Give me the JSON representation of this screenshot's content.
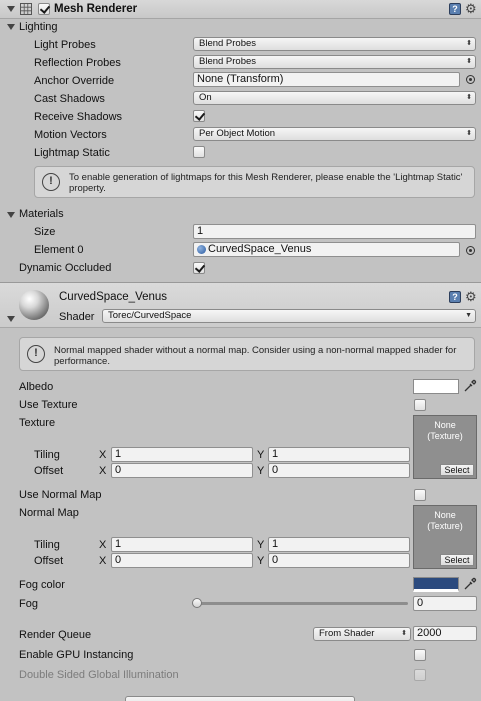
{
  "mesh_renderer": {
    "title": "Mesh Renderer",
    "enabled": true,
    "lighting_label": "Lighting",
    "light_probes": {
      "label": "Light Probes",
      "value": "Blend Probes"
    },
    "reflection_probes": {
      "label": "Reflection Probes",
      "value": "Blend Probes"
    },
    "anchor_override": {
      "label": "Anchor Override",
      "value": "None (Transform)"
    },
    "cast_shadows": {
      "label": "Cast Shadows",
      "value": "On"
    },
    "receive_shadows": {
      "label": "Receive Shadows",
      "checked": true
    },
    "motion_vectors": {
      "label": "Motion Vectors",
      "value": "Per Object Motion"
    },
    "lightmap_static": {
      "label": "Lightmap Static",
      "checked": false
    },
    "lightmap_help": "To enable generation of lightmaps for this Mesh Renderer, please enable the 'Lightmap Static' property.",
    "materials_label": "Materials",
    "size": {
      "label": "Size",
      "value": "1"
    },
    "element0": {
      "label": "Element 0",
      "value": "CurvedSpace_Venus"
    },
    "dynamic_occluded": {
      "label": "Dynamic Occluded",
      "checked": true
    }
  },
  "material": {
    "name": "CurvedSpace_Venus",
    "shader_label": "Shader",
    "shader_value": "Torec/CurvedSpace",
    "help": "Normal mapped shader without a normal map. Consider using a non-normal mapped shader for performance.",
    "albedo_label": "Albedo",
    "albedo_color": "#ffffff",
    "use_texture_label": "Use Texture",
    "texture_label": "Texture",
    "texture_slot": {
      "none": "None",
      "type": "(Texture)",
      "select": "Select"
    },
    "tiling_label": "Tiling",
    "offset_label": "Offset",
    "x_label": "X",
    "y_label": "Y",
    "texture_tiling": {
      "x": "1",
      "y": "1"
    },
    "texture_offset": {
      "x": "0",
      "y": "0"
    },
    "use_normal_map_label": "Use Normal Map",
    "normal_map_label": "Normal Map",
    "normal_slot": {
      "none": "None",
      "type": "(Texture)",
      "select": "Select"
    },
    "normal_tiling": {
      "x": "1",
      "y": "1"
    },
    "normal_offset": {
      "x": "0",
      "y": "0"
    },
    "fog_color_label": "Fog color",
    "fog_color": "#2b4a7e",
    "fog_label": "Fog",
    "fog_value": "0",
    "render_queue_label": "Render Queue",
    "render_queue_mode": "From Shader",
    "render_queue_value": "2000",
    "gpu_instancing_label": "Enable GPU Instancing",
    "double_sided_gi_label": "Double Sided Global Illumination"
  },
  "icons": [
    "fold-arrow-icon",
    "mesh-renderer-icon",
    "help-book-icon",
    "gear-icon",
    "info-icon",
    "object-picker-icon",
    "material-sphere-icon",
    "eyedropper-icon"
  ]
}
